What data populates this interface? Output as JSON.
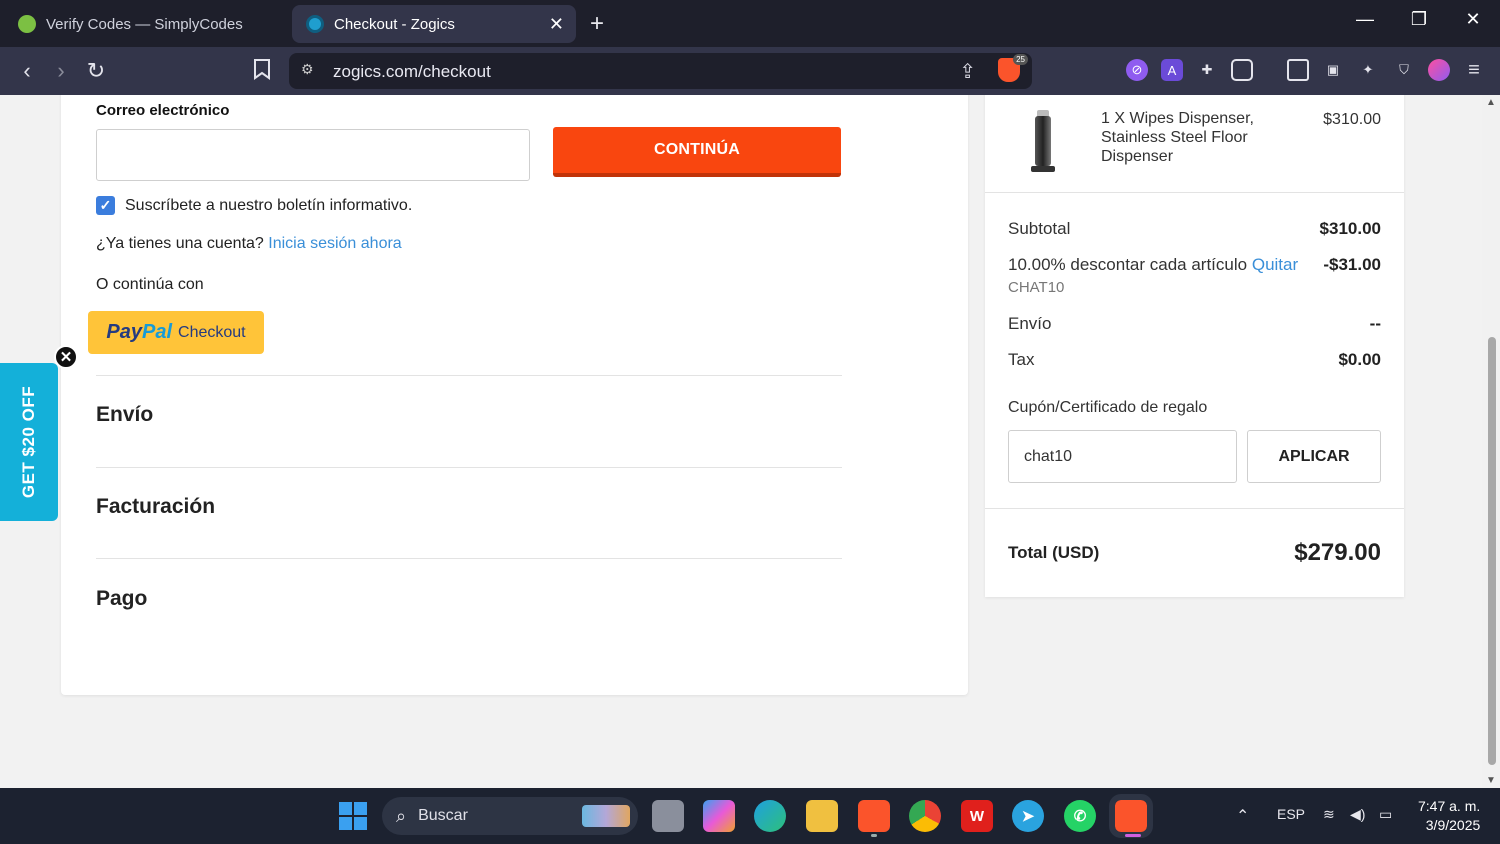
{
  "browser": {
    "tabs": [
      {
        "title": "Verify Codes — SimplyCodes",
        "active": false
      },
      {
        "title": "Checkout - Zogics",
        "active": true
      }
    ],
    "url": "zogics.com/checkout",
    "shields_badge": "25"
  },
  "checkout": {
    "email_label": "Correo electrónico",
    "email_value": "",
    "continue_label": "CONTINÚA",
    "newsletter_label": "Suscríbete a nuestro boletín informativo.",
    "newsletter_checked": true,
    "account_question": "¿Ya tienes una cuenta?",
    "login_link": "Inicia sesión ahora",
    "or_continue": "O continúa con",
    "paypal": {
      "pay": "Pay",
      "pal": "Pal",
      "checkout": "Checkout"
    },
    "sections": [
      "Envío",
      "Facturación",
      "Pago"
    ]
  },
  "promo": {
    "label": "GET $20 OFF",
    "close": "✕"
  },
  "summary": {
    "product": {
      "name": "1 X Wipes Dispenser, Stainless Steel Floor Dispenser",
      "price": "$310.00"
    },
    "subtotal_label": "Subtotal",
    "subtotal_value": "$310.00",
    "discount_label": "10.00% descontar cada artículo",
    "discount_remove": "Quitar",
    "discount_value": "-$31.00",
    "discount_code": "CHAT10",
    "shipping_label": "Envío",
    "shipping_value": "--",
    "tax_label": "Tax",
    "tax_value": "$0.00",
    "coupon_label": "Cupón/Certificado de regalo",
    "coupon_value": "chat10",
    "apply_label": "APLICAR",
    "total_label": "Total (USD)",
    "total_value": "$279.00"
  },
  "taskbar": {
    "search_placeholder": "Buscar",
    "language": "ESP",
    "time": "7:47 a. m.",
    "date": "3/9/2025"
  },
  "colors": {
    "accent_orange": "#f9460f",
    "link_blue": "#3a8fd8",
    "promo_cyan": "#14b0d9",
    "paypal_yellow": "#ffc439"
  }
}
